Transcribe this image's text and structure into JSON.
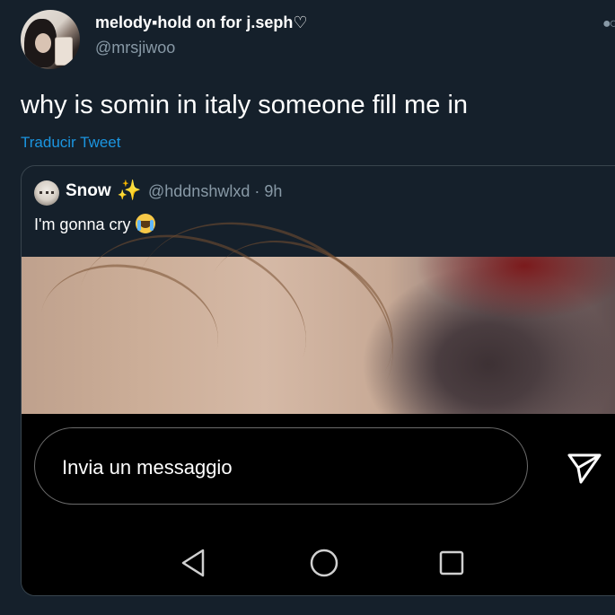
{
  "tweet": {
    "display_name": "melody▪hold on for j.seph♡",
    "handle": "@mrsjiwoo",
    "text": "why is somin in italy someone fill me in",
    "translate_label": "Traducir Tweet",
    "more_icon": "more-horizontal-icon"
  },
  "quoted_tweet": {
    "display_name": "Snow",
    "name_emoji": "✨",
    "handle_time": "@hddnshwlxd · 9h",
    "text": "I'm gonna cry",
    "text_emoji": "loudly-crying-face-icon"
  },
  "message_bar": {
    "placeholder": "Invia un messaggio",
    "send_icon": "send-icon"
  },
  "nav_bar": {
    "icons": [
      "back-icon",
      "home-icon",
      "recents-icon"
    ]
  },
  "colors": {
    "background": "#15202b",
    "accent": "#1b95e0",
    "secondary_text": "#8899a6",
    "border": "#38444d"
  }
}
